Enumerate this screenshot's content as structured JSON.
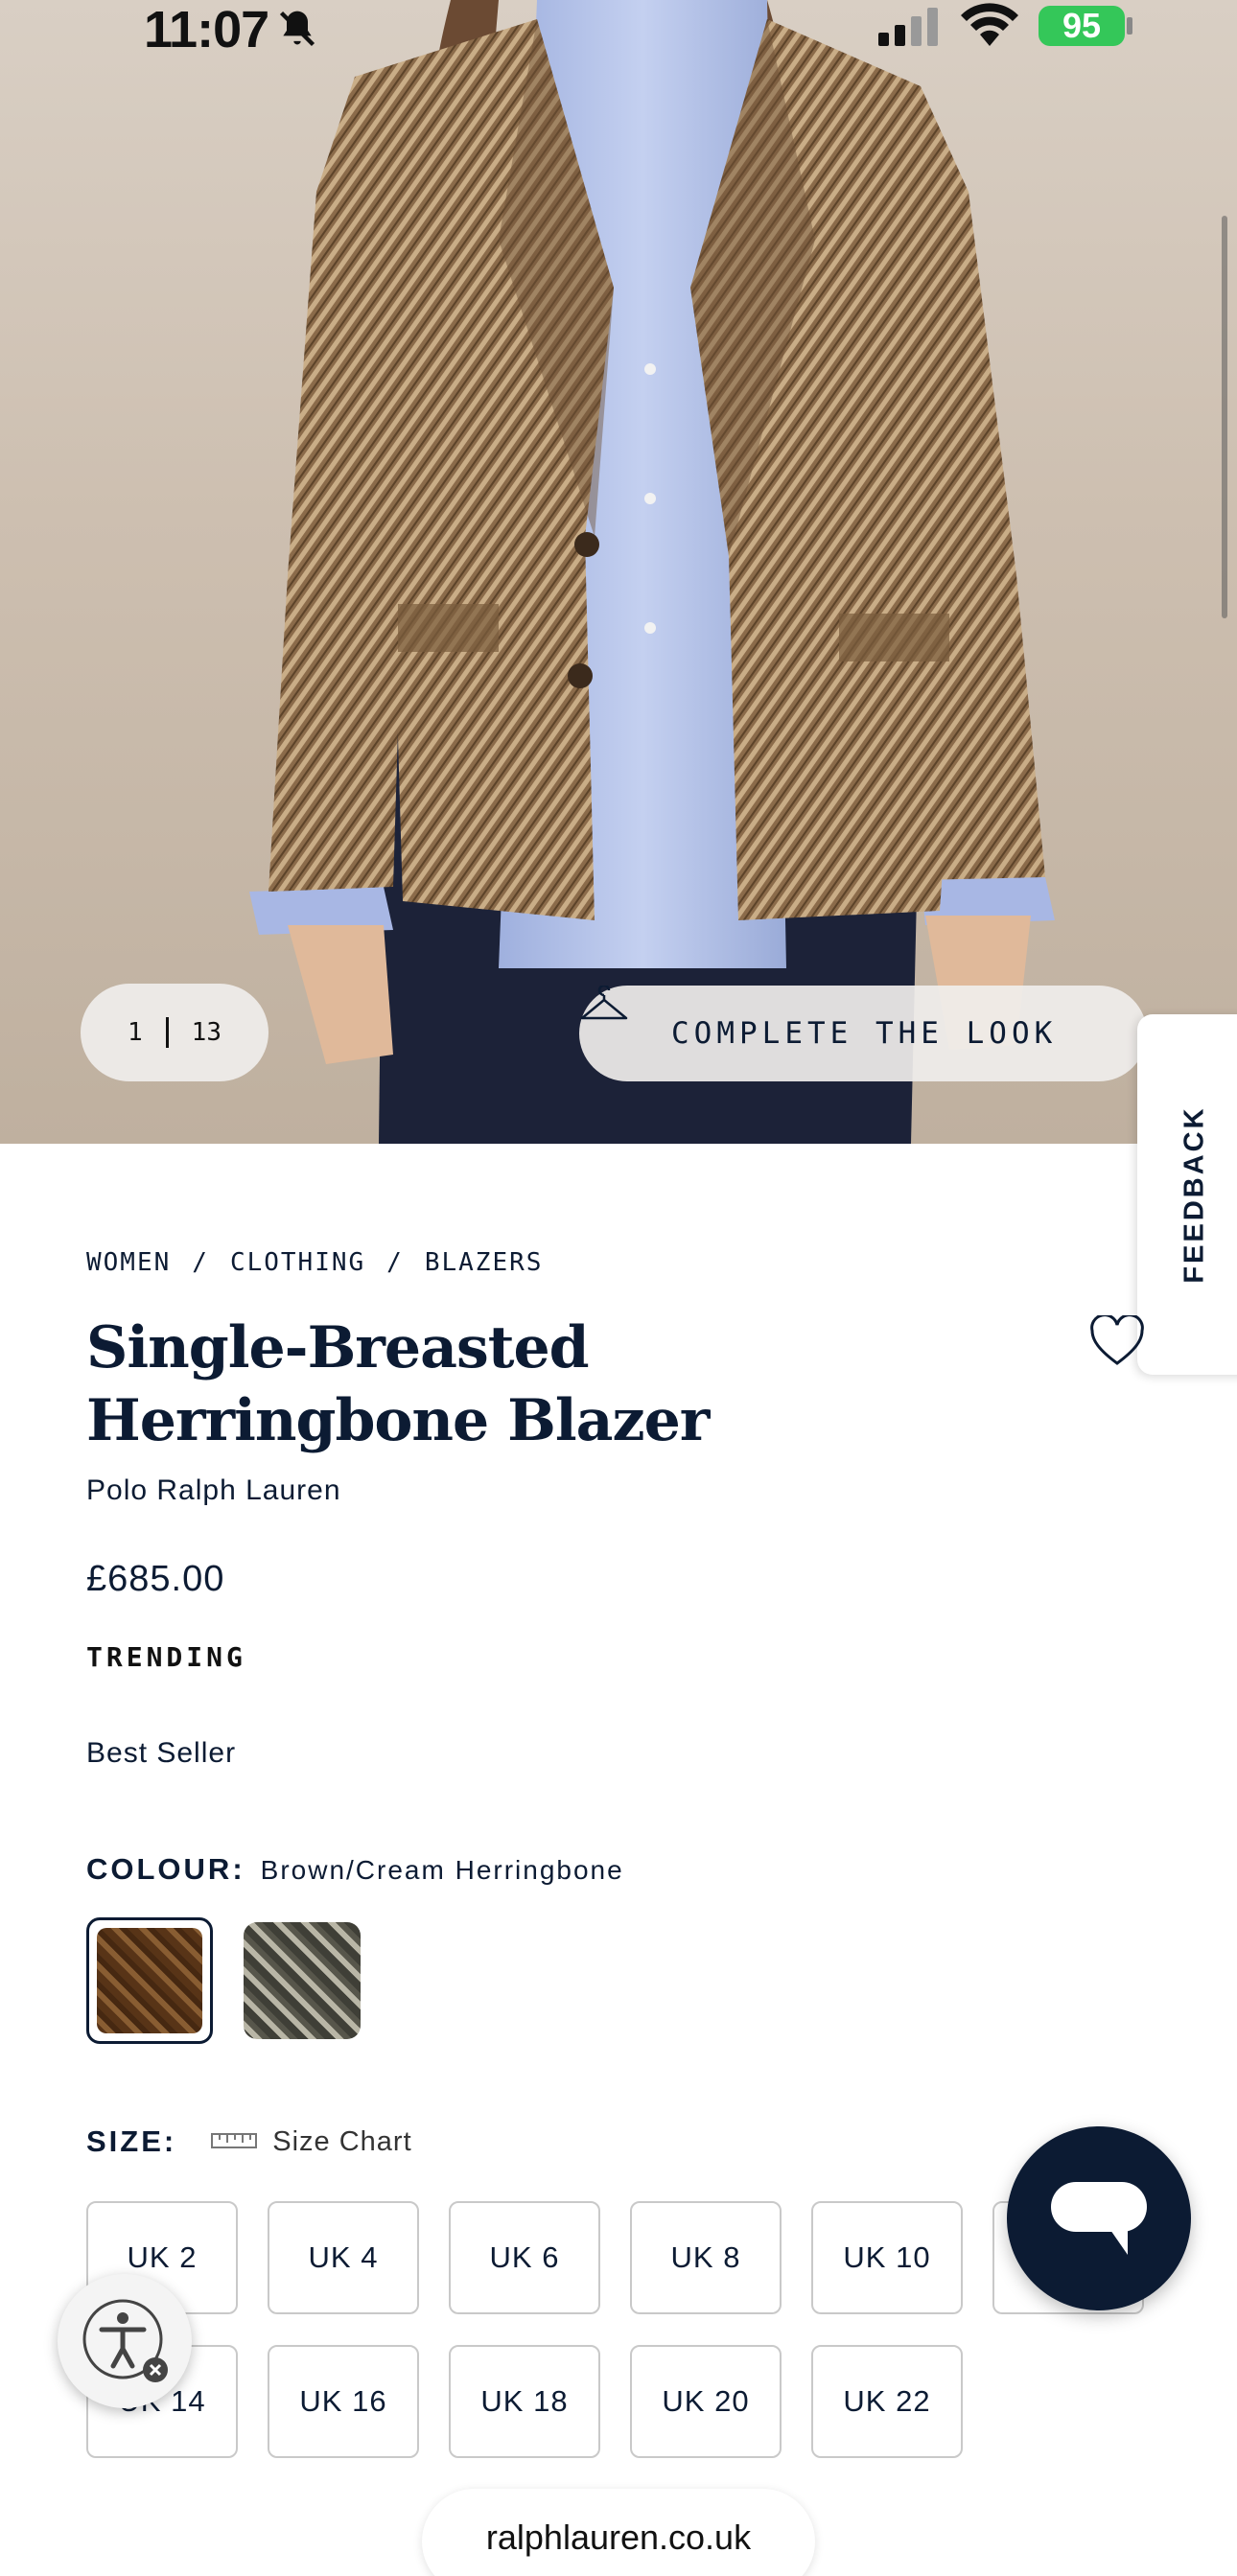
{
  "status_bar": {
    "time": "11:07",
    "battery": "95"
  },
  "gallery": {
    "current": "1",
    "total": "13",
    "complete_look_label": "COMPLETE THE LOOK"
  },
  "feedback_label": "FEEDBACK",
  "breadcrumb": [
    "WOMEN",
    "CLOTHING",
    "BLAZERS"
  ],
  "breadcrumb_separator": "/",
  "product": {
    "title": "Single-Breasted Herringbone Blazer",
    "brand": "Polo Ralph Lauren",
    "price": "£685.00",
    "badge": "TRENDING",
    "tag": "Best Seller"
  },
  "colour": {
    "label": "COLOUR:",
    "selected": "Brown/Cream Herringbone",
    "swatches": [
      "brown-herringbone",
      "grey-herringbone"
    ]
  },
  "size": {
    "label": "SIZE:",
    "chart_label": "Size Chart",
    "options": [
      "UK 2",
      "UK 4",
      "UK 6",
      "UK 8",
      "UK 10",
      "UK 12",
      "UK 14",
      "UK 16",
      "UK 18",
      "UK 20",
      "UK 22"
    ]
  },
  "browser": {
    "url": "ralphlauren.co.uk"
  },
  "colors": {
    "navy": "#0c1b33",
    "battery_green": "#34c759"
  },
  "icons": [
    "bell-slash-icon",
    "signal-icon",
    "wifi-icon",
    "hanger-icon",
    "heart-icon",
    "ruler-icon",
    "chat-icon",
    "accessibility-icon"
  ]
}
